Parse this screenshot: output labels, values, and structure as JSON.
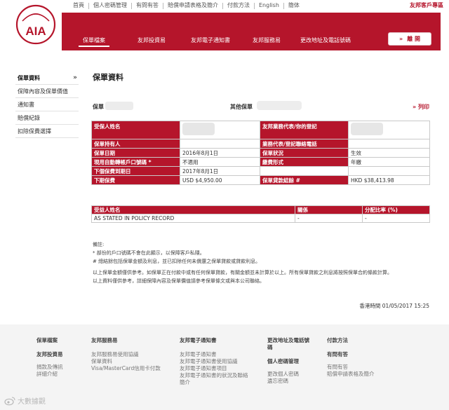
{
  "topbar": {
    "links": [
      "首頁",
      "個人密碼管理",
      "有問有答",
      "賠償申請表格及簡介",
      "付款方法",
      "English",
      "簡体"
    ],
    "portal_title": "友邦客戶專區"
  },
  "logo": {
    "text": "AIA",
    "color": "#b5152b"
  },
  "nav": {
    "tabs": [
      "保單檔案",
      "友邦投資易",
      "友邦電子通知書",
      "友邦服務易",
      "更改地址及電話號碼"
    ],
    "active_tab": "保單檔案",
    "logout_label": "離 開",
    "logout_arrow": "»",
    "accent_color": "#b5152b"
  },
  "sidebar": {
    "items": [
      {
        "label": "保單資料",
        "chev": "»"
      },
      {
        "label": "保障內容及保單價值"
      },
      {
        "label": "通知書"
      },
      {
        "label": "賠償紀錄"
      },
      {
        "label": "扣除保費選擇"
      }
    ]
  },
  "main": {
    "page_title": "保單資料",
    "policy_no_label": "保單",
    "other_policy_label": "其他保單",
    "print_label": "» 列印"
  },
  "policy_table": {
    "rows": [
      {
        "l1": "受保人姓名",
        "v1": "",
        "l2": "友邦業務代表/你的登記",
        "v2": ""
      },
      {
        "l1": "保單持有人",
        "v1": "",
        "l2": "業務代表/登記聯絡電話",
        "v2": ""
      },
      {
        "l1": "保單日期",
        "v1": "2016年8月1日",
        "l2": "保單狀況",
        "v2": "生效"
      },
      {
        "l1": "現用自動轉帳戶口號碼 *",
        "v1": "不適用",
        "l2": "繳費形式",
        "v2": "年繳"
      },
      {
        "l1": "下個保費到期日",
        "v1": "2017年8月1日",
        "l2": "",
        "v2": ""
      },
      {
        "l1": "下期保費",
        "v1": "USD  $4,950.00",
        "l2": "保單貸款結餘 #",
        "v2": "HKD  $38,413.98"
      }
    ]
  },
  "beneficiary_table": {
    "headers": [
      "受益人姓名",
      "關係",
      "分配比率 (%)"
    ],
    "rows": [
      {
        "name": "AS STATED IN POLICY RECORD",
        "relation": "-",
        "ratio": "-"
      }
    ]
  },
  "notes": {
    "title": "備註:",
    "lines": [
      "* 部份的戶口號碼不會在此顯示，以保障客戶私隱。",
      "# 總結餘包括保單金額及利息，並已扣除任何未償還之保單貸款或貸款利息。"
    ],
    "para1": "以上保單金額僅供參考。如保單正在付款中或有任何保單貸款，有關金額並未計算於以上。所有保單貸款之利息將按照保單合約條款計算。",
    "para2": "以上資料僅供參考，詳細保障內容及保單價值請參考保單條文或與本公司聯絡。",
    "hk_time": "香港時間 01/05/2017 15:25"
  },
  "footer": {
    "col1": {
      "heading": "保單檔案",
      "heading2": "友邦投資易",
      "links": [
        "捐款及傳訊",
        "詳細介紹"
      ]
    },
    "col2": {
      "heading": "友邦服務易",
      "links": [
        "友邦服務易使用協議",
        "保單資料",
        "Visa/MasterCard信用卡付款"
      ]
    },
    "col3": {
      "heading": "友邦電子通知書",
      "links": [
        "友邦電子通知書",
        "友邦電子通知書使用協議",
        "友邦電子通知書項目",
        "友邦電子通知書的狀況及聯絡",
        "簡介"
      ]
    },
    "col4": {
      "heading": "更改地址及電話號碼",
      "heading2": "個人密碼管理",
      "links": [
        "更改個人密碼",
        "遺忘密碼"
      ]
    },
    "col5": {
      "heading": "付款方法",
      "heading2": "有問有答",
      "links": [
        "有問有答",
        "賠償申請表格及簡介"
      ]
    }
  },
  "watermark": {
    "text": "大數據觀"
  }
}
